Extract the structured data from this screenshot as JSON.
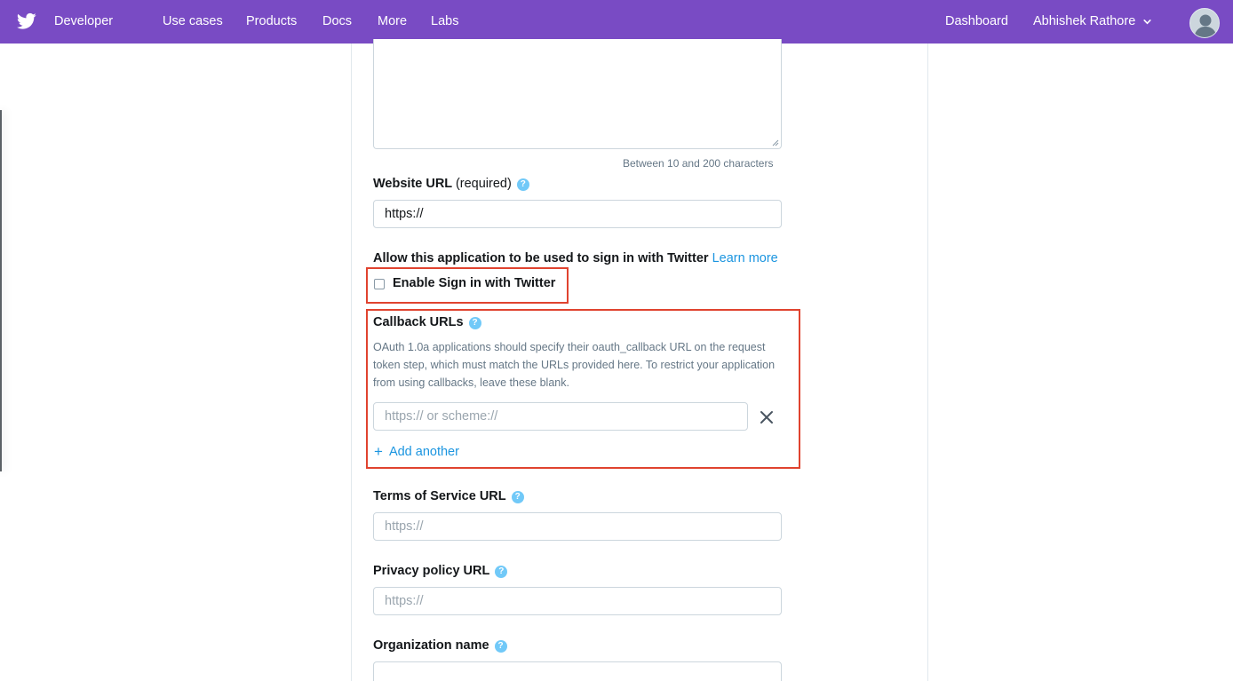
{
  "nav": {
    "brand": "Developer",
    "items": [
      "Use cases",
      "Products",
      "Docs",
      "More",
      "Labs"
    ],
    "dashboard": "Dashboard",
    "user": "Abhishek Rathore",
    "brand_color": "#794bc4"
  },
  "form": {
    "description_hint": "Between 10 and 200 characters",
    "website": {
      "label": "Website URL",
      "required": "(required)",
      "value": "https://"
    },
    "signin": {
      "label": "Allow this application to be used to sign in with Twitter",
      "learn_more": "Learn more",
      "checkbox_label": "Enable Sign in with Twitter",
      "checked": false
    },
    "callback": {
      "label": "Callback URLs",
      "description": "OAuth 1.0a applications should specify their oauth_callback URL on the request token step, which must match the URLs provided here. To restrict your application from using callbacks, leave these blank.",
      "placeholder": "https:// or scheme://",
      "add_another": "Add another"
    },
    "tos": {
      "label": "Terms of Service URL",
      "placeholder": "https://"
    },
    "privacy": {
      "label": "Privacy policy URL",
      "placeholder": "https://"
    },
    "org": {
      "label": "Organization name"
    }
  },
  "icons": {
    "help": "?",
    "plus": "+"
  },
  "colors": {
    "highlight_red": "#e0432f",
    "link_blue": "#1b95e0",
    "help_blue": "#71c9f8"
  }
}
